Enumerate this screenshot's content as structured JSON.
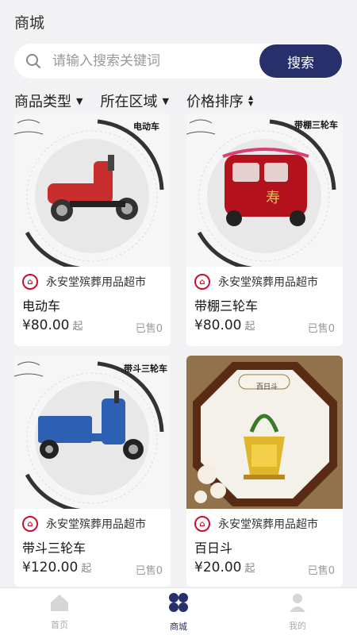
{
  "header": {
    "title": "商城"
  },
  "search": {
    "placeholder": "请输入搜索关键词",
    "button_label": "搜索"
  },
  "filters": [
    {
      "label": "商品类型"
    },
    {
      "label": "所在区域"
    },
    {
      "label": "价格排序"
    }
  ],
  "products": [
    {
      "image_caption": "电动车",
      "shop": "永安堂殡葬用品超市",
      "name": "电动车",
      "price": "¥80.00",
      "price_unit": "起",
      "sold": "已售0"
    },
    {
      "image_caption": "带棚三轮车",
      "shop": "永安堂殡葬用品超市",
      "name": "带棚三轮车",
      "price": "¥80.00",
      "price_unit": "起",
      "sold": "已售0"
    },
    {
      "image_caption": "带斗三轮车",
      "shop": "永安堂殡葬用品超市",
      "name": "带斗三轮车",
      "price": "¥120.00",
      "price_unit": "起",
      "sold": "已售0"
    },
    {
      "image_caption": "百日斗",
      "shop": "永安堂殡葬用品超市",
      "name": "百日斗",
      "price": "¥20.00",
      "price_unit": "起",
      "sold": "已售0"
    }
  ],
  "tabbar": {
    "items": [
      {
        "label": "首页",
        "icon": "home-icon"
      },
      {
        "label": "商城",
        "icon": "shop-grid-icon"
      },
      {
        "label": "我的",
        "icon": "user-icon"
      }
    ],
    "active": "商城"
  },
  "colors": {
    "accent": "#27306b",
    "brand_red": "#c8102e",
    "background": "#f2f2f4"
  }
}
